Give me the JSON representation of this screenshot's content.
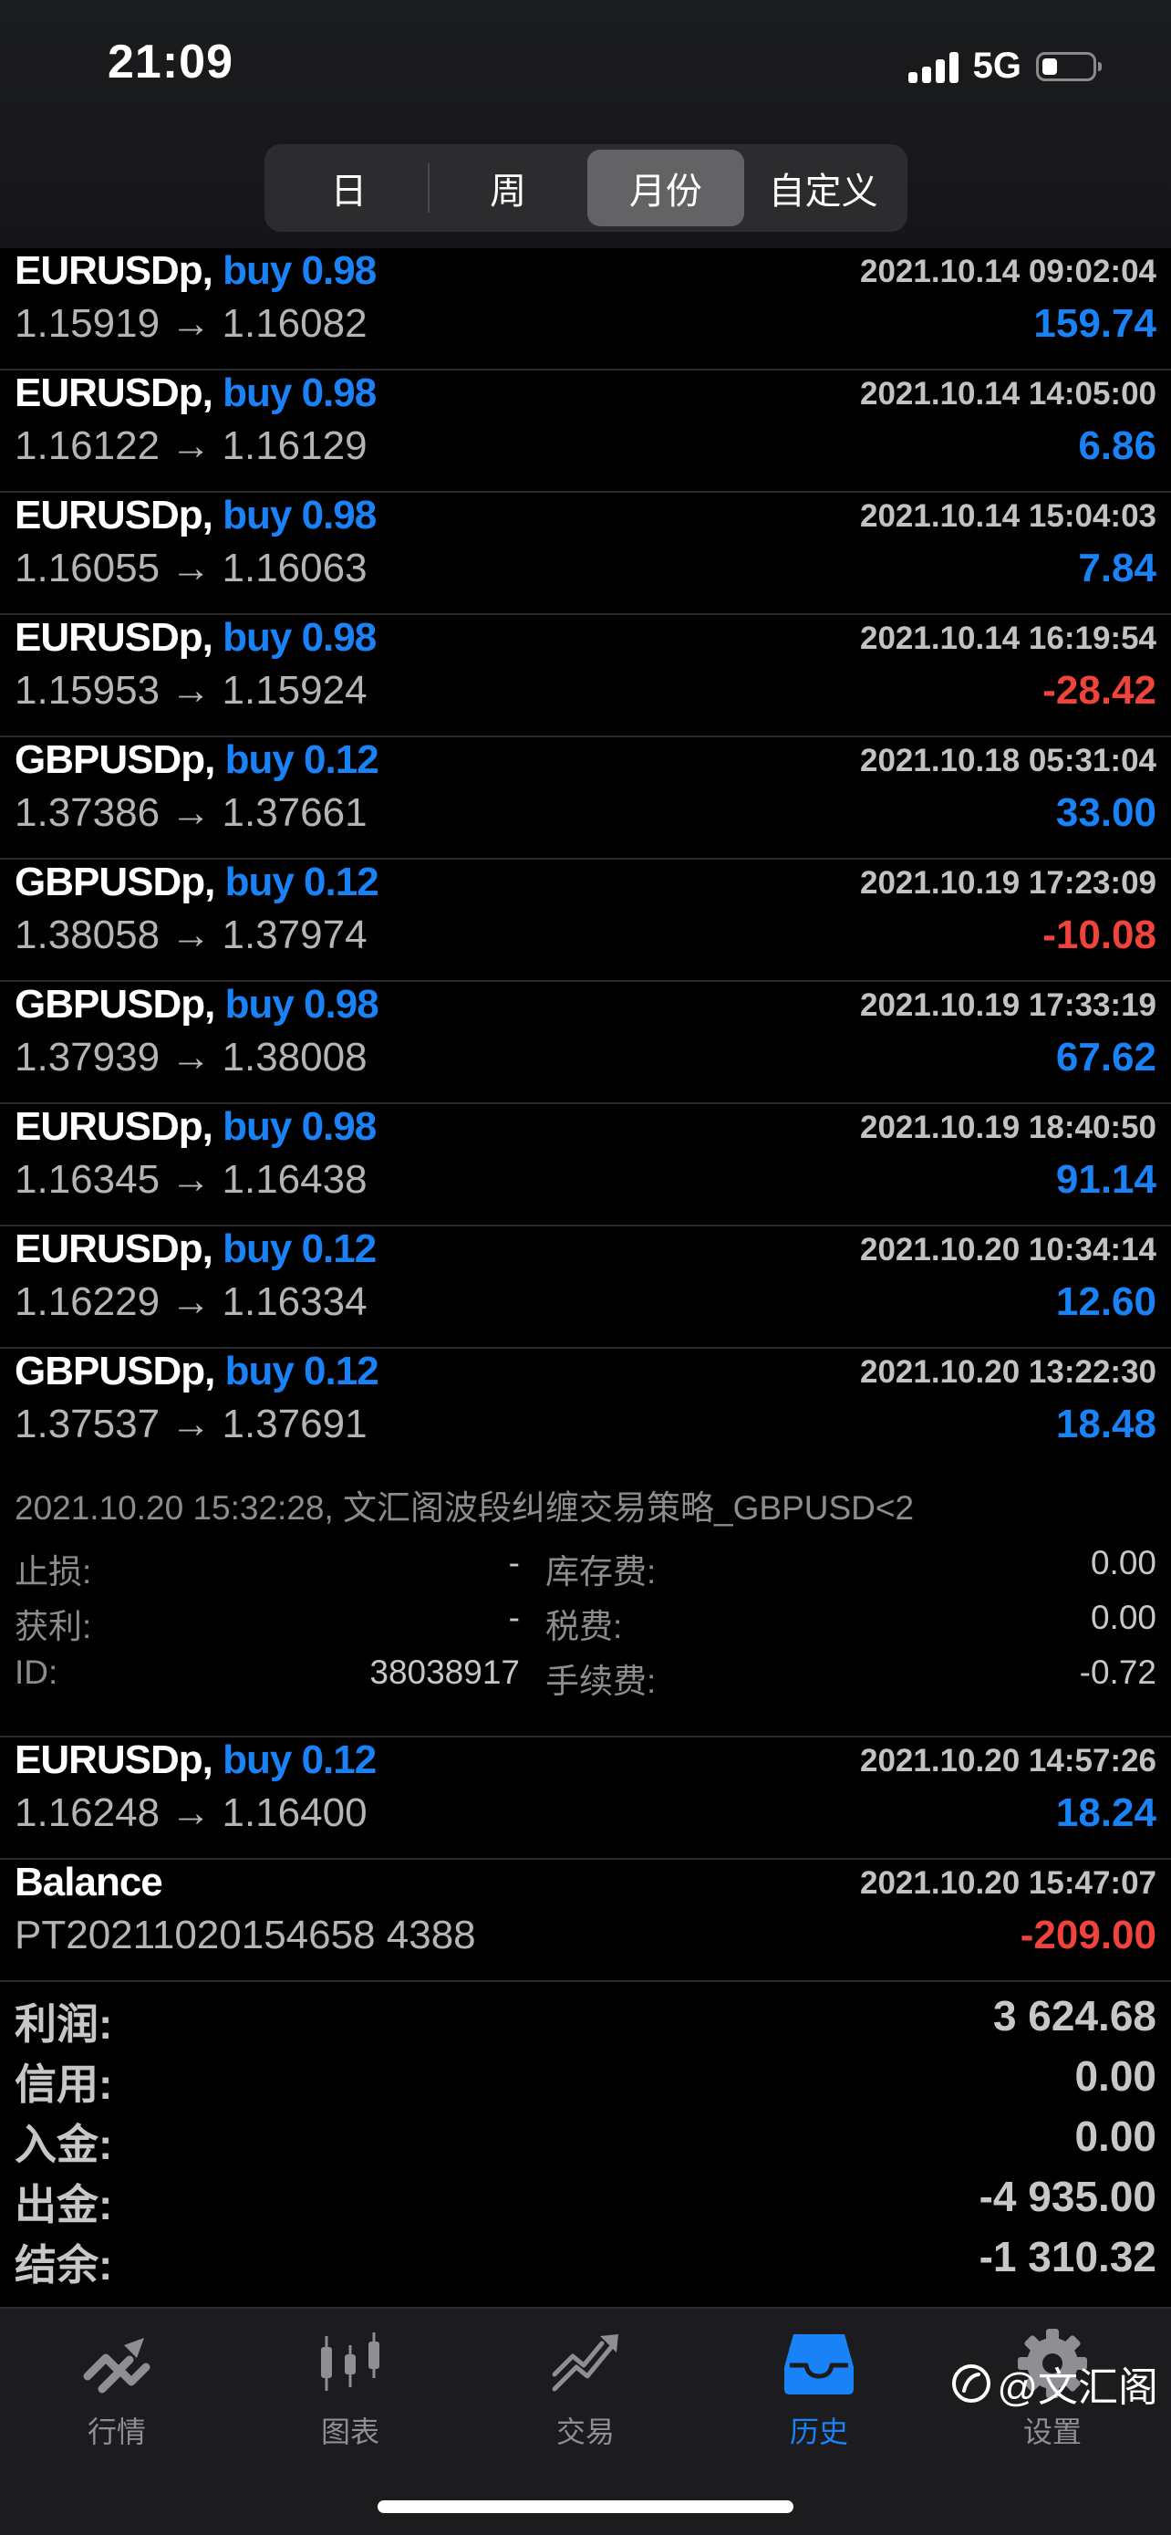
{
  "status": {
    "time": "21:09",
    "network": "5G"
  },
  "segments": [
    {
      "label": "日",
      "active": false
    },
    {
      "label": "周",
      "active": false
    },
    {
      "label": "月份",
      "active": true
    },
    {
      "label": "自定义",
      "active": false
    }
  ],
  "trades": [
    {
      "symbol": "EURUSDp,",
      "side": "buy 0.98",
      "time": "2021.10.14 09:02:04",
      "prices": "1.15919 → 1.16082",
      "profit": "159.74",
      "sign": "pos"
    },
    {
      "symbol": "EURUSDp,",
      "side": "buy 0.98",
      "time": "2021.10.14 14:05:00",
      "prices": "1.16122 → 1.16129",
      "profit": "6.86",
      "sign": "pos"
    },
    {
      "symbol": "EURUSDp,",
      "side": "buy 0.98",
      "time": "2021.10.14 15:04:03",
      "prices": "1.16055 → 1.16063",
      "profit": "7.84",
      "sign": "pos"
    },
    {
      "symbol": "EURUSDp,",
      "side": "buy 0.98",
      "time": "2021.10.14 16:19:54",
      "prices": "1.15953 → 1.15924",
      "profit": "-28.42",
      "sign": "neg"
    },
    {
      "symbol": "GBPUSDp,",
      "side": "buy 0.12",
      "time": "2021.10.18 05:31:04",
      "prices": "1.37386 → 1.37661",
      "profit": "33.00",
      "sign": "pos"
    },
    {
      "symbol": "GBPUSDp,",
      "side": "buy 0.12",
      "time": "2021.10.19 17:23:09",
      "prices": "1.38058 → 1.37974",
      "profit": "-10.08",
      "sign": "neg"
    },
    {
      "symbol": "GBPUSDp,",
      "side": "buy 0.98",
      "time": "2021.10.19 17:33:19",
      "prices": "1.37939 → 1.38008",
      "profit": "67.62",
      "sign": "pos"
    },
    {
      "symbol": "EURUSDp,",
      "side": "buy 0.98",
      "time": "2021.10.19 18:40:50",
      "prices": "1.16345 → 1.16438",
      "profit": "91.14",
      "sign": "pos"
    },
    {
      "symbol": "EURUSDp,",
      "side": "buy 0.12",
      "time": "2021.10.20 10:34:14",
      "prices": "1.16229 → 1.16334",
      "profit": "12.60",
      "sign": "pos"
    },
    {
      "symbol": "GBPUSDp,",
      "side": "buy 0.12",
      "time": "2021.10.20 13:22:30",
      "prices": "1.37537 → 1.37691",
      "profit": "18.48",
      "sign": "pos"
    }
  ],
  "detail": {
    "title": "2021.10.20 15:32:28, 文汇阁波段纠缠交易策略_GBPUSD<2",
    "stop_loss_label": "止损:",
    "stop_loss_value": "-",
    "take_profit_label": "获利:",
    "take_profit_value": "-",
    "id_label": "ID:",
    "id_value": "38038917",
    "swap_label": "库存费:",
    "swap_value": "0.00",
    "tax_label": "税费:",
    "tax_value": "0.00",
    "commission_label": "手续费:",
    "commission_value": "-0.72"
  },
  "trades_after": [
    {
      "symbol": "EURUSDp,",
      "side": "buy 0.12",
      "time": "2021.10.20 14:57:26",
      "prices": "1.16248 → 1.16400",
      "profit": "18.24",
      "sign": "pos"
    },
    {
      "symbol": "Balance",
      "side": "",
      "time": "2021.10.20 15:47:07",
      "prices": "PT20211020154658 4388",
      "profit": "-209.00",
      "sign": "neg"
    }
  ],
  "summary": [
    {
      "label": "利润:",
      "value": "3 624.68"
    },
    {
      "label": "信用:",
      "value": "0.00"
    },
    {
      "label": "入金:",
      "value": "0.00"
    },
    {
      "label": "出金:",
      "value": "-4 935.00"
    },
    {
      "label": "结余:",
      "value": "-1 310.32"
    }
  ],
  "tabs": [
    {
      "label": "行情",
      "icon": "quotes-icon",
      "active": false
    },
    {
      "label": "图表",
      "icon": "chart-icon",
      "active": false
    },
    {
      "label": "交易",
      "icon": "trade-icon",
      "active": false
    },
    {
      "label": "历史",
      "icon": "history-icon",
      "active": true
    },
    {
      "label": "设置",
      "icon": "settings-icon",
      "active": false
    }
  ],
  "watermark": "@文汇阁",
  "colors": {
    "buy": "#1a82f7",
    "positive": "#1a82f7",
    "negative": "#f0433a",
    "active_tab": "#1a82f7"
  }
}
